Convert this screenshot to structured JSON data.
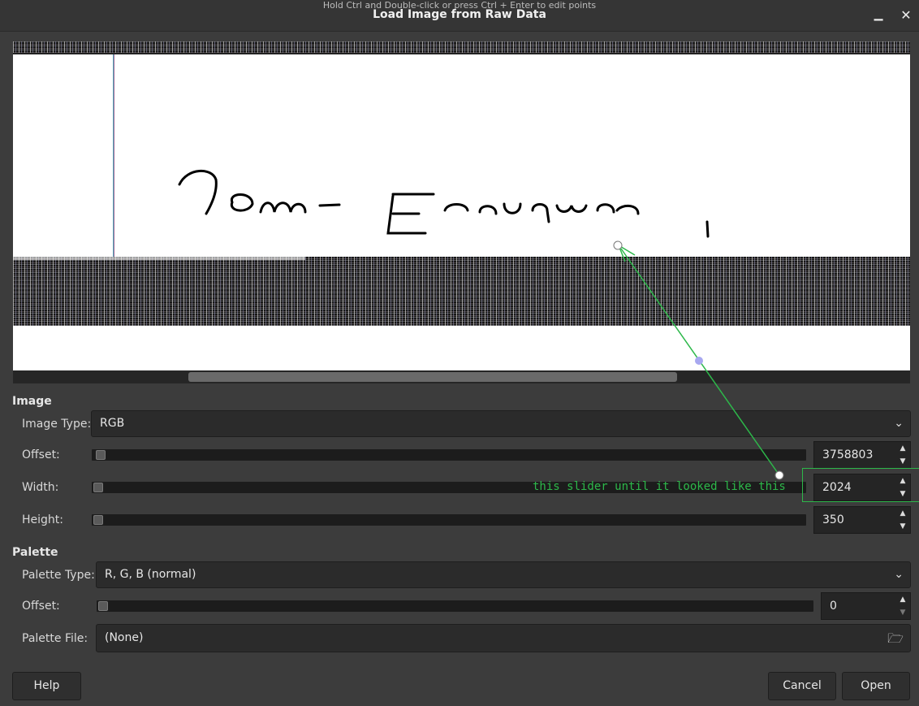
{
  "window": {
    "hint": "Hold Ctrl and Double-click or press Ctrl + Enter to edit points",
    "title": "Load Image from Raw Data",
    "minimize_icon": "minimize-icon",
    "close_icon": "close-icon"
  },
  "preview": {
    "handwriting": "Jom-Eonuqwo |"
  },
  "image_section": {
    "title": "Image",
    "image_type": {
      "label": "Image Type:",
      "value": "RGB"
    },
    "offset": {
      "label": "Offset:",
      "value": "3758803"
    },
    "width": {
      "label": "Width:",
      "value": "2024"
    },
    "height": {
      "label": "Height:",
      "value": "350"
    }
  },
  "palette_section": {
    "title": "Palette",
    "palette_type": {
      "label": "Palette Type:",
      "value": "R, G, B (normal)"
    },
    "offset": {
      "label": "Offset:",
      "value": "0"
    },
    "palette_file": {
      "label": "Palette File:",
      "value": "(None)"
    }
  },
  "annotation": {
    "text": "this slider until it looked like this",
    "color": "#2db84a"
  },
  "buttons": {
    "help": "Help",
    "cancel": "Cancel",
    "open": "Open"
  },
  "colors": {
    "background": "#3c3c3c",
    "input": "#2b2b2b",
    "handle_fill": "#ffffff",
    "handle_mid": "#a8a8f0"
  }
}
